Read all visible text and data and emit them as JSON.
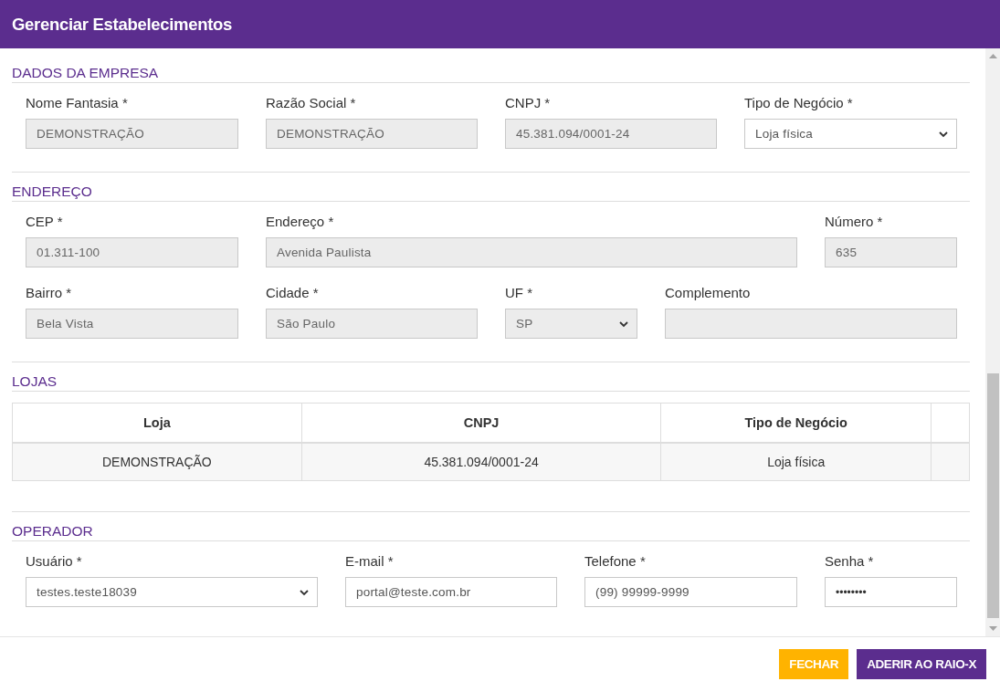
{
  "window": {
    "title": "Gerenciar Estabelecimentos"
  },
  "sections": [
    {
      "title": "DADOS DA EMPRESA",
      "kind": "fields",
      "rows": [
        [
          {
            "label": "Nome Fantasia *",
            "value": "DEMONSTRAÇÃO",
            "kind": "text",
            "disabled": true
          },
          {
            "label": "Razão Social *",
            "value": "DEMONSTRAÇÃO",
            "kind": "text",
            "disabled": true
          },
          {
            "label": "CNPJ *",
            "value": "45.381.094/0001-24",
            "kind": "text",
            "disabled": true
          },
          {
            "label": "Tipo de Negócio *",
            "value": "Loja física",
            "kind": "select",
            "disabled": false
          }
        ]
      ]
    },
    {
      "title": "ENDEREÇO",
      "kind": "fields",
      "rows": [
        [
          {
            "label": "CEP *",
            "value": "01.311-100",
            "kind": "text",
            "disabled": true
          },
          {
            "label": "Endereço *",
            "value": "Avenida Paulista",
            "kind": "text",
            "disabled": true
          },
          {
            "label": "Número *",
            "value": "635",
            "kind": "text",
            "disabled": true
          }
        ],
        [
          {
            "label": "Bairro *",
            "value": "Bela Vista",
            "kind": "text",
            "disabled": true
          },
          {
            "label": "Cidade *",
            "value": "São Paulo",
            "kind": "text",
            "disabled": true
          },
          {
            "label": "UF *",
            "value": "SP",
            "kind": "select",
            "disabled": true
          },
          {
            "label": "Complemento",
            "kind": "text",
            "disabled": true
          }
        ]
      ]
    },
    {
      "title": "LOJAS",
      "kind": "table",
      "columns": [
        "Loja",
        "CNPJ",
        "Tipo de Negócio"
      ],
      "rows": [
        [
          "DEMONSTRAÇÃO",
          "45.381.094/0001-24",
          "Loja física"
        ]
      ]
    },
    {
      "title": "OPERADOR",
      "kind": "fields",
      "rows": [
        [
          {
            "label": "Usuário *",
            "value": "testes.teste18039",
            "kind": "select",
            "disabled": false
          },
          {
            "label": "E-mail *",
            "value": "portal@teste.com.br",
            "kind": "text",
            "disabled": false
          },
          {
            "label": "Telefone *",
            "value": "(99) 99999-9999",
            "kind": "text",
            "disabled": false
          },
          {
            "label": "Senha *",
            "value": "••••••••",
            "kind": "password",
            "disabled": false
          }
        ]
      ]
    }
  ],
  "buttons": [
    {
      "label": "FECHAR",
      "kind": "secondary"
    },
    {
      "label": "ADERIR AO RAIO-X",
      "kind": "primary"
    }
  ]
}
